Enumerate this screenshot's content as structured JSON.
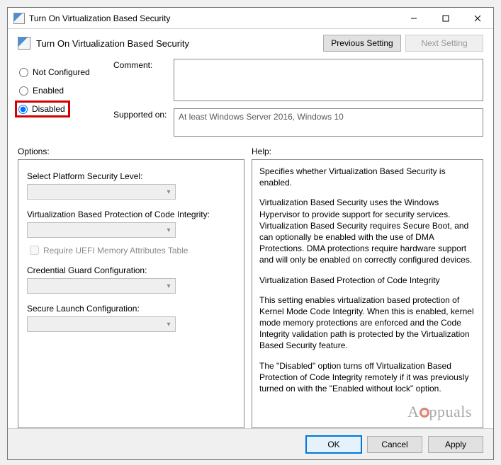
{
  "titlebar": {
    "title": "Turn On Virtualization Based Security"
  },
  "header": {
    "title": "Turn On Virtualization Based Security",
    "prev": "Previous Setting",
    "next": "Next Setting"
  },
  "radios": {
    "not_configured": "Not Configured",
    "enabled": "Enabled",
    "disabled": "Disabled",
    "selected": "disabled"
  },
  "comment": {
    "label": "Comment:",
    "value": ""
  },
  "supported": {
    "label": "Supported on:",
    "value": "At least Windows Server 2016, Windows 10"
  },
  "sections": {
    "options": "Options:",
    "help": "Help:"
  },
  "options": {
    "platform_level": "Select Platform Security Level:",
    "code_integrity": "Virtualization Based Protection of Code Integrity:",
    "uefi_check": "Require UEFI Memory Attributes Table",
    "cred_guard": "Credential Guard Configuration:",
    "secure_launch": "Secure Launch Configuration:"
  },
  "help": {
    "p1": "Specifies whether Virtualization Based Security is enabled.",
    "p2": "Virtualization Based Security uses the Windows Hypervisor to provide support for security services. Virtualization Based Security requires Secure Boot, and can optionally be enabled with the use of DMA Protections. DMA protections require hardware support and will only be enabled on correctly configured devices.",
    "p3": "Virtualization Based Protection of Code Integrity",
    "p4": "This setting enables virtualization based protection of Kernel Mode Code Integrity. When this is enabled, kernel mode memory protections are enforced and the Code Integrity validation path is protected by the Virtualization Based Security feature.",
    "p5": "The \"Disabled\" option turns off Virtualization Based Protection of Code Integrity remotely if it was previously turned on with the \"Enabled without lock\" option."
  },
  "footer": {
    "ok": "OK",
    "cancel": "Cancel",
    "apply": "Apply"
  },
  "watermark": "ppuals"
}
